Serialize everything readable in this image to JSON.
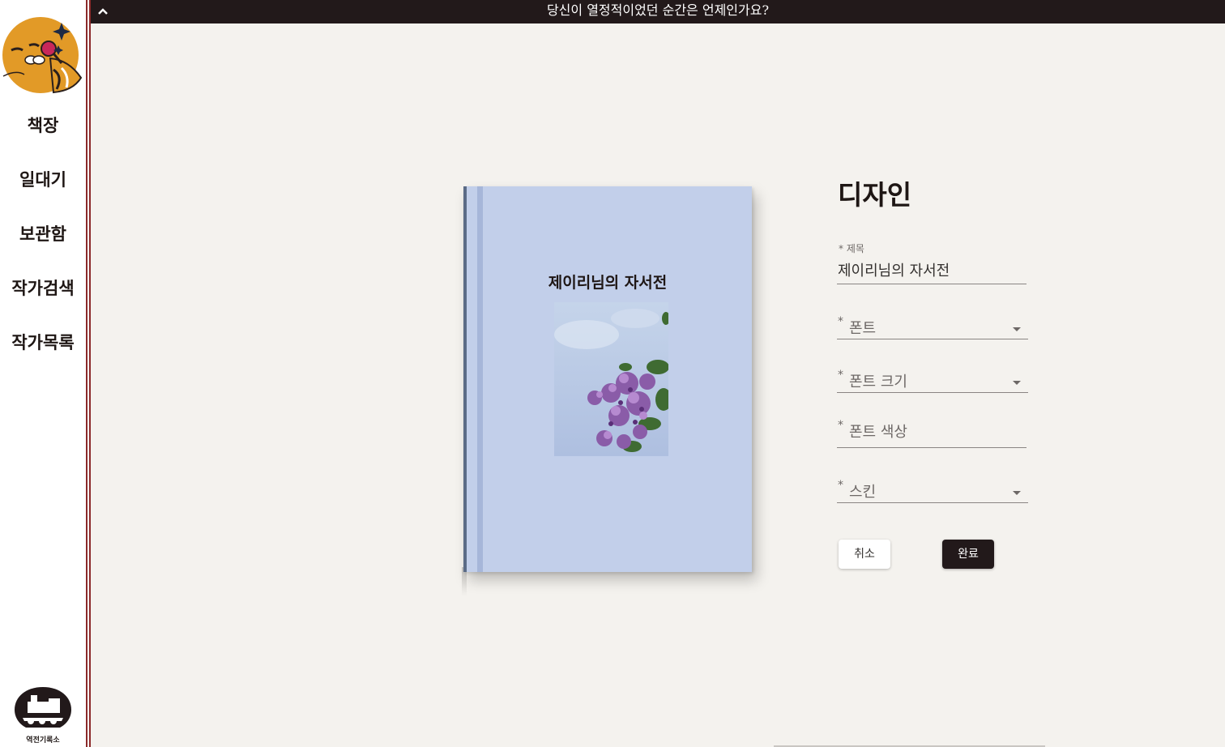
{
  "sidebar": {
    "items": [
      {
        "label": "책장"
      },
      {
        "label": "일대기"
      },
      {
        "label": "보관함"
      },
      {
        "label": "작가검색"
      },
      {
        "label": "작가목록"
      }
    ],
    "brand_label": "역전기록소",
    "mascot_icon": "mascot-icon",
    "brand_icon": "train-logo-icon"
  },
  "banner": {
    "question": "당신이 열정적이었던 순간은 언제인가요?",
    "toggle_icon": "chevron-up-icon"
  },
  "book": {
    "title": "제이리님의 자서전",
    "cover_color": "#c2cfea",
    "image": "lilac-flowers-photo"
  },
  "form": {
    "heading": "디자인",
    "title_field": {
      "label": "* 제목",
      "value": "제이리님의 자서전"
    },
    "font_field": {
      "asterisk": "*",
      "placeholder": "폰트"
    },
    "font_size_field": {
      "asterisk": "*",
      "placeholder": "폰트 크기"
    },
    "font_color_field": {
      "asterisk": "*",
      "placeholder": "폰트 색상"
    },
    "skin_field": {
      "asterisk": "*",
      "placeholder": "스킨"
    },
    "cancel_label": "취소",
    "done_label": "완료"
  },
  "colors": {
    "accent_dark": "#22191a",
    "sidebar_rule": "#8c2a2a",
    "background": "#f4f2ee"
  }
}
